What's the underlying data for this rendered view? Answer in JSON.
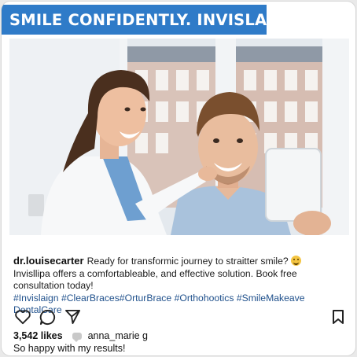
{
  "banner": {
    "text": "SMILE CONFIDENTLY. INVISLAGN"
  },
  "post": {
    "username": "dr.louisecarter",
    "caption_line1": "Ready for transformic journey to straitter smile?",
    "caption_line2": "Invisllipa offers a comfortableable, and effective solution. Book free consultation today!",
    "hashtags_line1": "#Invislaign #ClearBraces#OrturBrace #Orthohootics #SmileMakeave",
    "hashtags_line2": "DentalCare",
    "emoji": "grinning-face-emoji"
  },
  "actions": {
    "like_icon": "heart-icon",
    "comment_icon": "comment-icon",
    "share_icon": "send-icon",
    "save_icon": "bookmark-icon"
  },
  "engagement": {
    "likes": "3,542 likes",
    "comment_user": "anna_marie g",
    "comment_text": "So happy with my results!"
  },
  "colors": {
    "banner_bg": "#2f7bc8",
    "banner_text": "#ffffff",
    "hashtag": "#20518c"
  }
}
